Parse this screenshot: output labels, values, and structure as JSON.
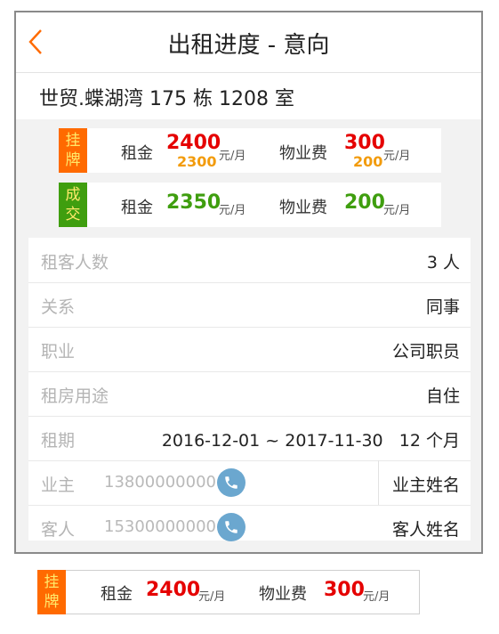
{
  "header": {
    "title": "出租进度 - 意向"
  },
  "property": {
    "address": "世贸.蝶湖湾   175 栋 1208 室"
  },
  "listing": {
    "tag": "挂牌",
    "rent_label": "租金",
    "rent_value": "2400",
    "rent_prev": "2300",
    "unit": "元/月",
    "fee_label": "物业费",
    "fee_value": "300",
    "fee_prev": "200"
  },
  "deal": {
    "tag": "成交",
    "rent_label": "租金",
    "rent_value": "2350",
    "unit": "元/月",
    "fee_label": "物业费",
    "fee_value": "200"
  },
  "details": {
    "tenants_label": "租客人数",
    "tenants_value": "3 人",
    "relation_label": "关系",
    "relation_value": "同事",
    "job_label": "职业",
    "job_value": "公司职员",
    "purpose_label": "租房用途",
    "purpose_value": "自住",
    "term_label": "租期",
    "term_value": "2016-12-01 ~ 2017-11-30   12 个月",
    "owner_label": "业主",
    "owner_phone": "13800000000",
    "owner_name": "业主姓名",
    "guest_label": "客人",
    "guest_phone": "15300000000",
    "guest_name": "客人姓名"
  },
  "listing_bottom": {
    "tag": "挂牌",
    "rent_label": "租金",
    "rent_value": "2400",
    "unit": "元/月",
    "fee_label": "物业费",
    "fee_value": "300"
  },
  "colors": {
    "accent": "#ff6a00",
    "deal": "#3f9e0f",
    "price_red": "#e50000",
    "call": "#6ba7cf"
  },
  "icons": {
    "back": "chevron-left-icon",
    "call": "phone-icon"
  }
}
